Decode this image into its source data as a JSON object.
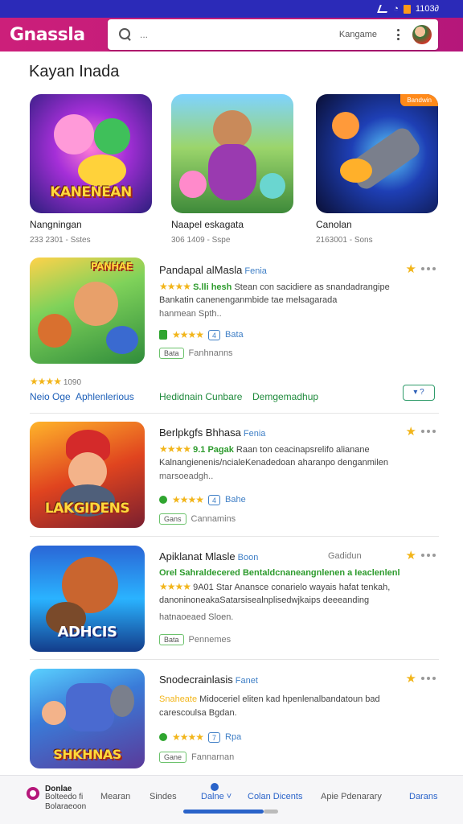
{
  "status_bar": {
    "time": "1103∂",
    "battery_color": "#ff9a1a"
  },
  "app_bar": {
    "logo": "Gnassla",
    "search_placeholder": "...",
    "filter_label": "Kangame",
    "brand_color": "#c71d7a"
  },
  "section": {
    "title": "Kayan Inada"
  },
  "featured": [
    {
      "name": "Nangningan",
      "meta": "233 2301 - Sstes",
      "art_title": "KANENEAN",
      "badge": ""
    },
    {
      "name": "Naapel eskagata",
      "meta": "306 1409 - Sspe",
      "art_title": "",
      "badge": ""
    },
    {
      "name": "Canolan",
      "meta": "2163001 - Sons",
      "art_title": "",
      "badge": "Bandwin"
    }
  ],
  "apps": [
    {
      "title": "Pandapal alMasla",
      "tag": "Fenia",
      "art_title": "PANHAE",
      "line1_stars": "★★★★",
      "line1_green": "S.lli hesh",
      "line1_text": "Stean con sacidiere as snandadrangipe",
      "line2": "Bankatin canenenganmbide tae melsagarada",
      "line3": "hanmean Spth..",
      "row_stars": "★★★★",
      "row_num": "4",
      "row_label": "Bata",
      "btn": "Bata",
      "btn_label": "Fanhnanns"
    },
    {
      "title": "Berlpkgfs Bhhasa",
      "tag": "Fenia",
      "art_title": "LAKGIDENS",
      "line1_stars": "★★★★",
      "line1_green": "9.1 Pagak",
      "line1_text": "Raan ton ceacinapsrelifo alianane",
      "line2": "Kalnangienenis/ncialeKenadedoan aharanpo denganmilen",
      "line3": "marsoeadgh..",
      "row_stars": "★★★★",
      "row_num": "4",
      "row_label": "Bahe",
      "btn": "Gans",
      "btn_label": "Cannamins"
    },
    {
      "title": "Apiklanat Mlasle",
      "tag": "Boon",
      "right_text": "Gadidun",
      "art_title": "ADHCIS",
      "line1_green": "Orel Sahraldecered Bentaldcnaneangnlenen a Ieaclenlenl",
      "line2_stars": "★★★★",
      "line2_text": "9A01 Star Anansce conarielo wayais hafat tenkah,",
      "line3": "danoninoneakaSatarsisealnplisedwjkaips deeeanding",
      "line4": "hatnaoeaed Sloen.",
      "btn": "Bata",
      "btn_label": "Pennemes"
    },
    {
      "title": "Snodecrainlasis",
      "tag": "Fanet",
      "art_title": "SHKHNAS",
      "line1_text": "Midoceriel eliten kad hpenlenalbandatoun bad",
      "line1_prefix": "Snaheate",
      "line2": "carescoulsa Bgdan.",
      "row_stars": "★★★★",
      "row_num": "7",
      "row_label": "Rpa",
      "btn": "Gane",
      "btn_label": "Fannarnan"
    }
  ],
  "links": {
    "stars": "★★★★",
    "count": "1090",
    "left": "Neio Oge",
    "left2": "Aphlenlerious",
    "mid": "Hedidnain Cunbare",
    "mid2": "Demgemadhup",
    "dl_label": "▾ ?"
  },
  "nav": {
    "app_title": "Donlae",
    "app_sub": "Bolteedo fi",
    "app_sub2": "Bolaraeoon",
    "items": [
      "Mearan",
      "Sindes",
      "Dalne",
      "Colan Dicents",
      "Apie Pdenarary",
      "Darans"
    ]
  }
}
